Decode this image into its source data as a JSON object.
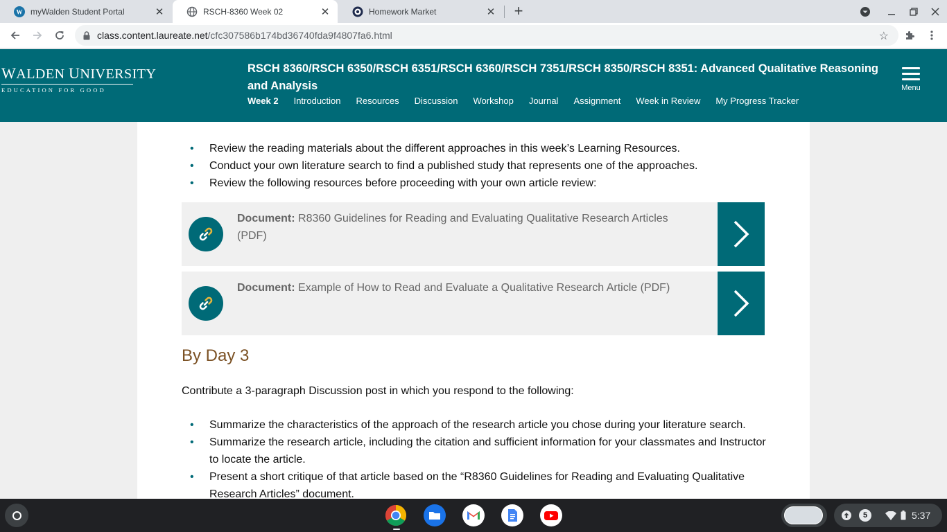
{
  "browser": {
    "tabs": [
      {
        "title": "myWalden Student Portal",
        "favicon": "walden-w-icon",
        "active": false
      },
      {
        "title": "RSCH-8360 Week 02",
        "favicon": "globe-icon",
        "active": true
      },
      {
        "title": "Homework Market",
        "favicon": "homework-market-icon",
        "active": false
      }
    ],
    "url_host": "class.content.laureate.net",
    "url_path": "/cfc307586b174bd36740fda9f4807fa6.html"
  },
  "header": {
    "logo_main_first": "W",
    "logo_main_rest": "ALDEN ",
    "logo_main_first2": "U",
    "logo_main_rest2": "NIVERSITY",
    "logo_sub": "EDUCATION FOR GOOD",
    "course_title": "RSCH 8360/RSCH 6350/RSCH 6351/RSCH 6360/RSCH 7351/RSCH 8350/RSCH 8351: Advanced Qualitative Reasoning and Analysis",
    "nav": {
      "week": "Week 2",
      "introduction": "Introduction",
      "resources": "Resources",
      "discussion": "Discussion",
      "workshop": "Workshop",
      "journal": "Journal",
      "assignment": "Assignment",
      "week_in_review": "Week in Review",
      "progress_tracker": "My Progress Tracker"
    },
    "menu_label": "Menu"
  },
  "content": {
    "bullets_top": [
      "Review the reading materials about the different approaches in this week’s Learning Resources.",
      "Conduct your own literature search to find a published study that represents one of the approaches.",
      "Review the following resources before proceeding with your own article review:"
    ],
    "documents": [
      {
        "label": "Document:",
        "title": "R8360 Guidelines for Reading and Evaluating Qualitative Research Articles (PDF)"
      },
      {
        "label": "Document:",
        "title": "Example of How to Read and Evaluate a Qualitative Research Article (PDF)"
      }
    ],
    "day_heading": "By Day 3",
    "instruction": "Contribute a 3-paragraph Discussion post in which you respond to the following:",
    "bullets_bottom": [
      "Summarize the characteristics of the approach of the research article you chose during your literature search.",
      "Summarize the research article, including the citation and sufficient information for your classmates and Instructor to locate the article.",
      "Present a short critique of that article based on the “R8360 Guidelines for Reading and Evaluating Qualitative Research Articles” document."
    ]
  },
  "shelf": {
    "apps": [
      "chrome-icon",
      "files-icon",
      "gmail-icon",
      "docs-icon",
      "youtube-icon"
    ],
    "notification_count": "5",
    "time": "5:37"
  },
  "colors": {
    "brand_teal": "#006a77",
    "heading_brown": "#7b5124"
  }
}
